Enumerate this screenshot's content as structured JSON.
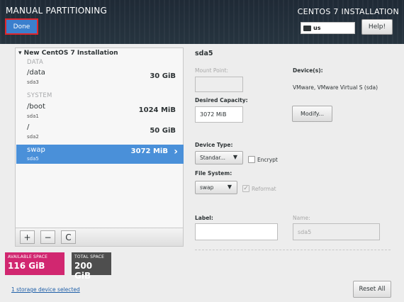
{
  "header": {
    "title": "MANUAL PARTITIONING",
    "done_label": "Done",
    "install_title": "CENTOS 7 INSTALLATION",
    "keyboard_layout": "us",
    "help_label": "Help!"
  },
  "tree": {
    "root_label": "New CentOS 7 Installation",
    "categories": [
      "DATA",
      "SYSTEM"
    ],
    "partitions": [
      {
        "mount": "/data",
        "device": "sda3",
        "size": "30 GiB"
      },
      {
        "mount": "/boot",
        "device": "sda1",
        "size": "1024 MiB"
      },
      {
        "mount": "/",
        "device": "sda2",
        "size": "50 GiB"
      },
      {
        "mount": "swap",
        "device": "sda5",
        "size": "3072 MiB"
      }
    ],
    "selected_index": 3
  },
  "toolbar": {
    "add": "+",
    "remove": "−",
    "refresh": "C"
  },
  "space": {
    "available_label": "AVAILABLE SPACE",
    "available_value": "116 GiB",
    "total_label": "TOTAL SPACE",
    "total_value": "200 GiB"
  },
  "footer": {
    "storage_link": "1 storage device selected",
    "reset_label": "Reset All"
  },
  "details": {
    "title": "sda5",
    "mount_point_label": "Mount Point:",
    "mount_point_value": "",
    "desired_capacity_label": "Desired Capacity:",
    "desired_capacity_value": "3072 MiB",
    "devices_label": "Device(s):",
    "devices_value": "VMware, VMware Virtual S (sda)",
    "modify_label": "Modify...",
    "device_type_label": "Device Type:",
    "device_type_value": "Standar...",
    "encrypt_label": "Encrypt",
    "file_system_label": "File System:",
    "file_system_value": "swap",
    "reformat_label": "Reformat",
    "label_label": "Label:",
    "label_value": "",
    "name_label": "Name:",
    "name_value": "sda5"
  },
  "colors": {
    "header_bg": "#1f2a36",
    "done_bg": "#3b7fcd",
    "highlight_border": "#e0262b",
    "selected_row": "#4a90d9",
    "available_space": "#d12770",
    "total_space": "#4e4e4e"
  }
}
